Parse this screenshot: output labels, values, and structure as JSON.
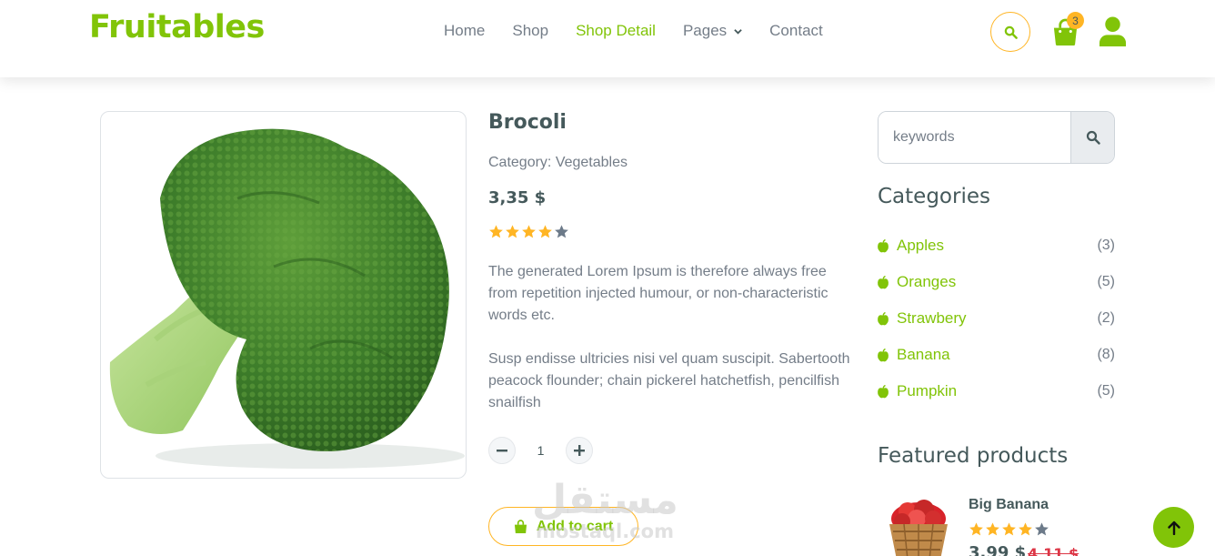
{
  "brand": "Fruitables",
  "nav": {
    "links": [
      "Home",
      "Shop",
      "Shop Detail",
      "Pages",
      "Contact"
    ],
    "active": "Shop Detail",
    "cart_count": "3",
    "accent": "#81c408",
    "secondary": "#ffb524"
  },
  "product": {
    "title": "Brocoli",
    "category": "Category: Vegetables",
    "price": "3,35 $",
    "rating": 4,
    "rating_max": 5,
    "desc1": "The generated Lorem Ipsum is therefore always free from repetition injected humour, or non-characteristic words etc.",
    "desc2": "Susp endisse ultricies nisi vel quam suscipit. Sabertooth peacock flounder; chain pickerel hatchetfish, pencilfish snailfish",
    "quantity": "1",
    "add_to_cart": "Add to cart"
  },
  "sidebar": {
    "search_placeholder": "keywords",
    "categories_title": "Categories",
    "categories": [
      {
        "name": "Apples",
        "count": "(3)"
      },
      {
        "name": "Oranges",
        "count": "(5)"
      },
      {
        "name": "Strawbery",
        "count": "(2)"
      },
      {
        "name": "Banana",
        "count": "(8)"
      },
      {
        "name": "Pumpkin",
        "count": "(5)"
      }
    ],
    "featured_title": "Featured products",
    "featured": {
      "name": "Big Banana",
      "rating": 4,
      "price": "3.99 $",
      "old_price": "4.11 $"
    }
  },
  "watermark": {
    "arabic": "مستقل",
    "latin": "mostaql.com"
  }
}
